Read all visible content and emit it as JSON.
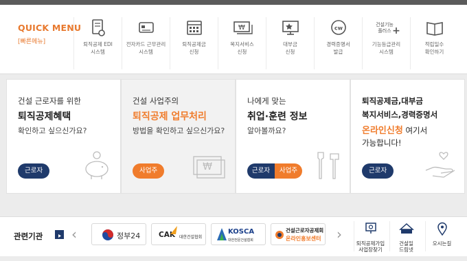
{
  "quick_menu": {
    "title": "QUICK MENU",
    "subtitle": "[빠른메뉴]",
    "items": [
      {
        "icon": "document-gear-icon",
        "label": "퇴직공제 EDI\n시스템"
      },
      {
        "icon": "card-icon",
        "label": "전자카드 근무관리\n시스템"
      },
      {
        "icon": "calendar-icon",
        "label": "퇴직공제금\n신청"
      },
      {
        "icon": "won-money-icon",
        "label": "복지서비스\n신청"
      },
      {
        "icon": "monitor-star-icon",
        "label": "대부금\n신청"
      },
      {
        "icon": "cwa-certificate-icon",
        "label": "경력증명서\n발급"
      },
      {
        "icon": "skill-plus-icon",
        "label": "기능등급관리\n시스템"
      },
      {
        "icon": "book-icon",
        "label": "적립일수\n확인하기"
      }
    ],
    "skill_icon_text": "건설기능\n플러스"
  },
  "cards": [
    {
      "line1": "건설 근로자를 위한",
      "line2": "퇴직공제혜택",
      "line3": "확인하고 싶으신가요?",
      "button": "근로자",
      "icon": "piggy-bank-icon"
    },
    {
      "line1": "건설 사업주의",
      "line2": "퇴직공제 업무처리",
      "line3": "방법을 확인하고 싶으신가요?",
      "button": "사업주",
      "icon": "won-bill-icon"
    },
    {
      "line1": "나에게 맞는",
      "line2": "취업·훈련 정보",
      "line3": "알아볼까요?",
      "button_left": "근로자",
      "button_right": "사업주",
      "icon": "tools-icon"
    },
    {
      "line1": "퇴직공제금,대부금",
      "line2": "복지서비스,경력증명서",
      "line3": "온라인신청",
      "line3b": " 여기서",
      "line4": "가능합니다!",
      "button": "근로자",
      "icon": "hand-heart-icon"
    }
  ],
  "related": {
    "title": "관련기관",
    "logos": [
      {
        "name": "정부24"
      },
      {
        "name": "CAK",
        "sub": "대한건설협회"
      },
      {
        "name": "KOSCA",
        "sub": "대한전문건설협회"
      },
      {
        "name": "건설근로자공제회",
        "sub": "온라인홍보센터"
      }
    ],
    "sites": [
      {
        "label": "퇴직공제가입\n사업장찾기"
      },
      {
        "label": "건설일\n드림넷"
      },
      {
        "label": "오시는길"
      }
    ]
  },
  "colors": {
    "accent": "#f07c2c",
    "navy": "#1f3a6b"
  }
}
